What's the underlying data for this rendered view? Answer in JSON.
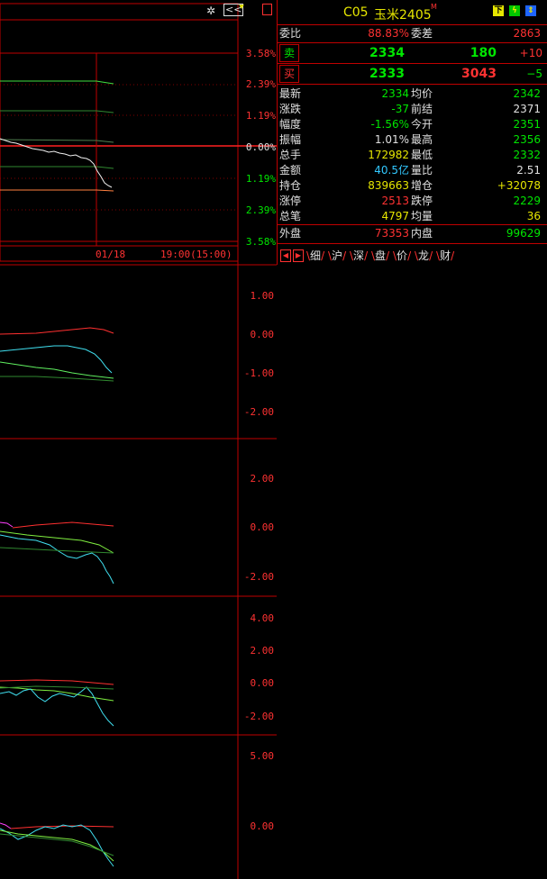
{
  "header": {
    "code": "C05",
    "name": "玉米2405",
    "mark": "M",
    "btn_down": "下",
    "collapse_glyph": "<<"
  },
  "order_book": {
    "ratio_label": "委比",
    "ratio_value": "88.83%",
    "diff_label": "委差",
    "diff_value": "2863",
    "sell_label": "卖",
    "sell_price": "2334",
    "sell_vol": "180",
    "sell_change": "+10",
    "buy_label": "买",
    "buy_price": "2333",
    "buy_vol": "3043",
    "buy_change": "−5"
  },
  "stats": [
    {
      "l1": "最新",
      "v1": "2334",
      "c1": "green",
      "l2": "均价",
      "v2": "2342",
      "c2": "green"
    },
    {
      "l1": "涨跌",
      "v1": "-37",
      "c1": "green",
      "l2": "前结",
      "v2": "2371",
      "c2": "white"
    },
    {
      "l1": "幅度",
      "v1": "-1.56%",
      "c1": "green",
      "l2": "今开",
      "v2": "2351",
      "c2": "green"
    },
    {
      "l1": "振幅",
      "v1": "1.01%",
      "c1": "white",
      "l2": "最高",
      "v2": "2356",
      "c2": "green"
    },
    {
      "l1": "总手",
      "v1": "172982",
      "c1": "yellow",
      "l2": "最低",
      "v2": "2332",
      "c2": "green"
    },
    {
      "l1": "金额",
      "v1": "40.5亿",
      "c1": "cyan",
      "l2": "量比",
      "v2": "2.51",
      "c2": "white"
    },
    {
      "l1": "持仓",
      "v1": "839663",
      "c1": "yellow",
      "l2": "增仓",
      "v2": "+32078",
      "c2": "yellow"
    },
    {
      "l1": "涨停",
      "v1": "2513",
      "c1": "red",
      "l2": "跌停",
      "v2": "2229",
      "c2": "green"
    },
    {
      "l1": "总笔",
      "v1": "4797",
      "c1": "yellow",
      "l2": "均量",
      "v2": "36",
      "c2": "yellow"
    }
  ],
  "outer_inner": {
    "outer_label": "外盘",
    "outer_value": "73353",
    "inner_label": "内盘",
    "inner_value": "99629"
  },
  "tabs": [
    "细",
    "沪",
    "深",
    "盘",
    "价",
    "龙",
    "财"
  ],
  "main_chart": {
    "y_labels": [
      "3.58%",
      "2.39%",
      "1.19%",
      "0.00%",
      "1.19%",
      "2.39%",
      "3.58%"
    ],
    "date_label": "01/18",
    "time_label": "19:00(15:00)"
  },
  "panel1": {
    "y_labels": [
      "1.00",
      "0.00",
      "-1.00",
      "-2.00"
    ]
  },
  "panel2": {
    "y_labels": [
      "2.00",
      "0.00",
      "-2.00"
    ]
  },
  "panel3": {
    "y_labels": [
      "4.00",
      "2.00",
      "0.00",
      "-2.00"
    ]
  },
  "panel4": {
    "y_labels": [
      "5.00",
      "0.00"
    ]
  }
}
